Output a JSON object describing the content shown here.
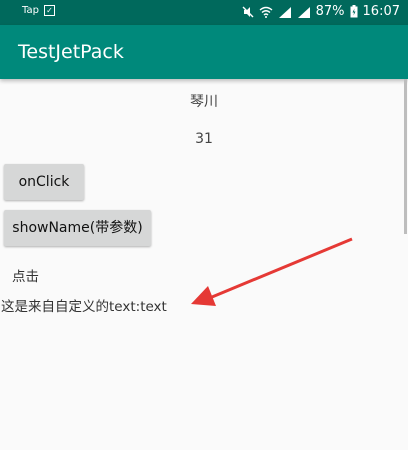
{
  "status_bar": {
    "left_label": "Tap",
    "check_glyph": "✓",
    "battery_percent": "87%",
    "time": "16:07",
    "icons": [
      "mute-icon",
      "wifi-icon",
      "signal-icon",
      "signal-icon",
      "battery-icon"
    ]
  },
  "app_bar": {
    "title": "TestJetPack",
    "color": "#00897b",
    "status_color": "#00695c"
  },
  "content": {
    "name_text": "琴川",
    "age_text": "31",
    "onclick_button": "onClick",
    "showname_button": "showName(带参数)",
    "click_label": "点击",
    "custom_text": "这是来自自定义的text:text"
  },
  "annotation": {
    "arrow_color": "#e53935"
  }
}
